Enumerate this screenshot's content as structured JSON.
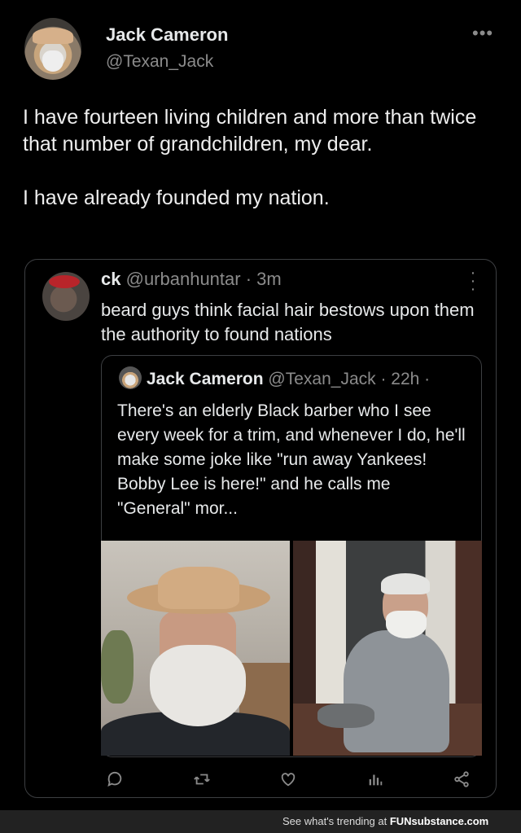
{
  "tweet": {
    "author_name": "Jack Cameron",
    "author_handle": "@Texan_Jack",
    "more": "•••",
    "text_line1": "I have fourteen living children and more than twice that number of grandchildren, my dear.",
    "text_line2": "I have already founded my nation."
  },
  "quote": {
    "name": "ck",
    "handle": "@urbanhuntar · 3m",
    "text": "beard guys think facial hair bestows upon them the authority to found nations",
    "inner": {
      "name": "Jack Cameron",
      "handle": "@Texan_Jack · 22h ·",
      "text": "There's an elderly Black barber who I see every week for a trim, and whenever I do, he'll make some joke like \"run away Yankees! Bobby Lee is here!\" and he calls me \"General\" mor..."
    }
  },
  "actions": [
    "reply-icon",
    "retweet-icon",
    "like-icon",
    "views-icon",
    "share-icon"
  ],
  "footer": {
    "text": "See what's trending at ",
    "brand": "FUNsubstance.com"
  }
}
